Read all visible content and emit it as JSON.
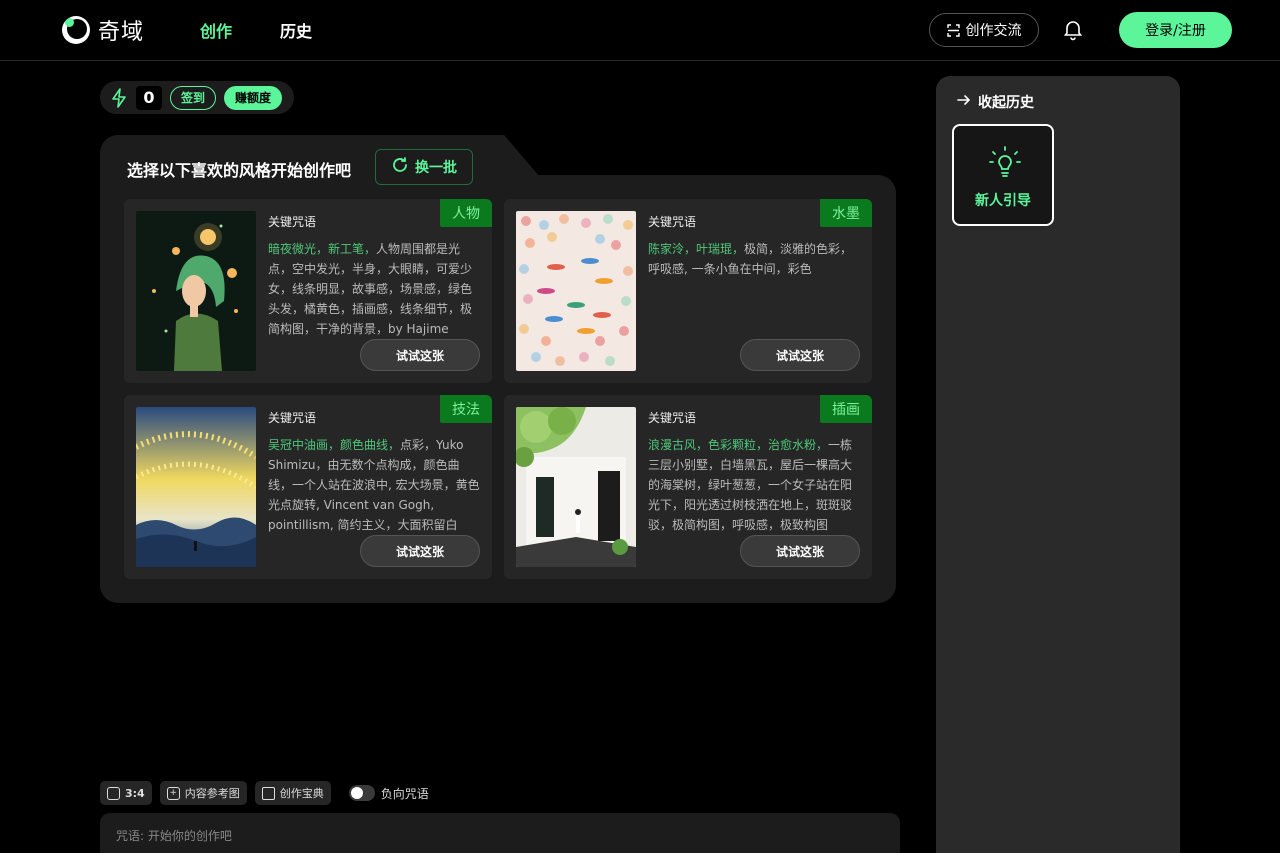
{
  "header": {
    "logo_text": "奇域",
    "nav": [
      "创作",
      "历史"
    ],
    "community_label": "创作交流",
    "login_label": "登录/注册"
  },
  "credits": {
    "count": "0",
    "checkin_label": "签到",
    "earn_label": "赚额度"
  },
  "panel": {
    "title": "选择以下喜欢的风格开始创作吧",
    "refresh_label": "换一批",
    "cards": [
      {
        "tag": "人物",
        "keyword_label": "关键咒语",
        "highlight": "暗夜微光，新工笔，",
        "text": "人物周围都是光点，空中发光，半身，大眼睛，可爱少女，线条明显，故事感，场景感，绿色头发，橘黄色，插画感，线条细节，极简构图，干净的背景，by Hajime",
        "button": "试试这张"
      },
      {
        "tag": "水墨",
        "keyword_label": "关键咒语",
        "highlight": "陈家泠，叶瑞琨，",
        "text": "极简，淡雅的色彩，呼吸感, 一条小鱼在中间，彩色",
        "button": "试试这张"
      },
      {
        "tag": "技法",
        "keyword_label": "关键咒语",
        "highlight": "吴冠中油画，颜色曲线，",
        "text": "点彩，Yuko Shimizu，由无数个点构成，颜色曲线，一个人站在波浪中, 宏大场景，黄色光点旋转, Vincent van Gogh, pointillism, 简约主义，大面积留白",
        "button": "试试这张"
      },
      {
        "tag": "插画",
        "keyword_label": "关键咒语",
        "highlight": "浪漫古风，色彩颗粒，治愈水粉，",
        "text": "一栋三层小别墅，白墙黑瓦，屋后一棵高大的海棠树，绿叶葱葱，一个女子站在阳光下，阳光透过树枝洒在地上，斑斑驳驳，极简构图，呼吸感，极致构图",
        "button": "试试这张"
      }
    ]
  },
  "toolbar": {
    "ratio_label": "3:4",
    "ref_label": "内容参考图",
    "guide_label": "创作宝典",
    "negative_label": "负向咒语"
  },
  "prompt": {
    "placeholder": "咒语: 开始你的创作吧"
  },
  "history": {
    "collapse_label": "收起历史",
    "guide_label": "新人引导"
  },
  "colors": {
    "accent": "#5cf59a",
    "tag_bg": "#0b7a1e",
    "panel_bg": "#1c1c1c"
  }
}
